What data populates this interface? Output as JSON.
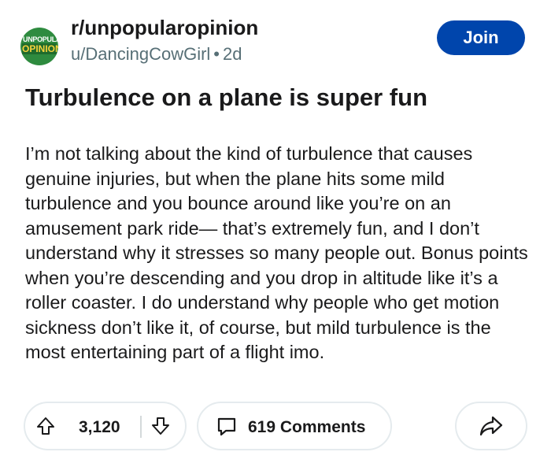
{
  "header": {
    "avatar_top": "UNPOPULAR",
    "avatar_bottom": "OPINION",
    "subreddit": "r/unpopularopinion",
    "author": "u/DancingCowGirl",
    "separator": "•",
    "age": "2d",
    "join_label": "Join"
  },
  "post": {
    "title": "Turbulence on a plane is super fun",
    "body": "I’m not talking about the kind of turbulence that causes genuine injuries, but when the plane hits some mild turbulence and you bounce around like you’re on an amusement park ride— that’s extremely fun, and I don’t understand why it stresses so many people out. Bonus points when you’re descending and you drop in altitude like it’s a roller coaster. I do understand why people who get motion sickness don’t like it, of course, but mild turbulence is the most entertaining part of a flight imo."
  },
  "actions": {
    "score": "3,120",
    "comments_label": "619 Comments",
    "icons": [
      "upvote-icon",
      "downvote-icon",
      "comment-icon",
      "share-icon"
    ]
  },
  "colors": {
    "join_bg": "#0045ac",
    "avatar_green": "#2e8b3f",
    "meta_gray": "#576f76",
    "pill_border": "#e5ebee"
  }
}
